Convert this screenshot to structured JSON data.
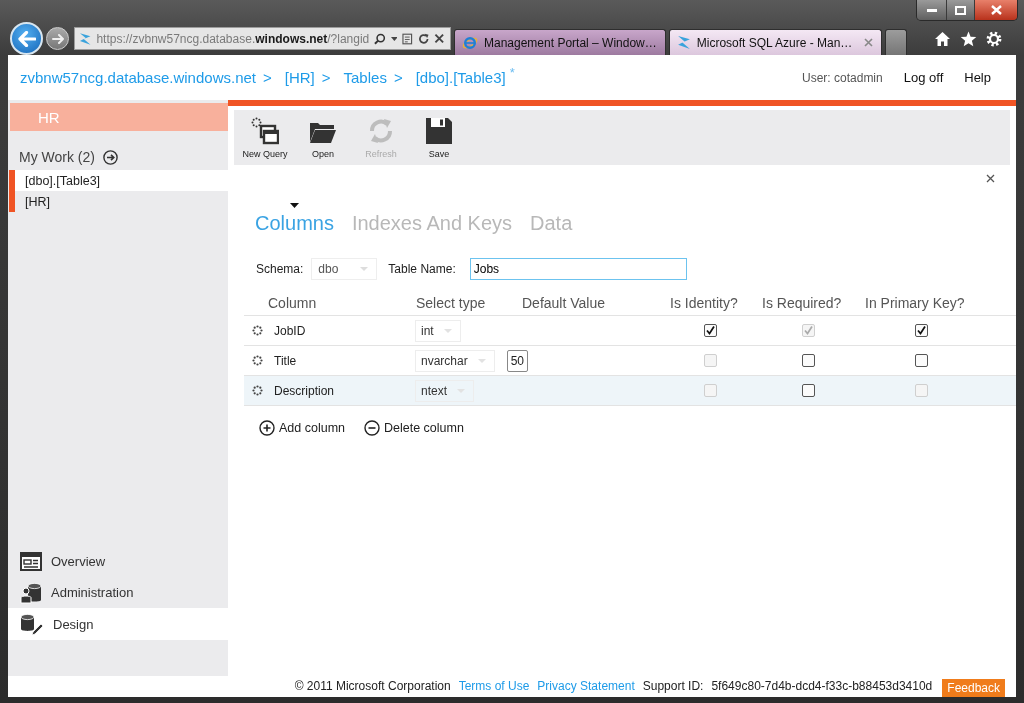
{
  "browser": {
    "address": "https://zvbnw57ncg.database.**windows.net**/?langid",
    "tabs": [
      {
        "title": "Management Portal – Window…",
        "kind": "ie",
        "selected": false
      },
      {
        "title": "Microsoft SQL Azure - Man…",
        "kind": "azure",
        "selected": true
      }
    ]
  },
  "header": {
    "breadcrumb": [
      {
        "label": "zvbnw57ncg.database.windows.net",
        "separator": ">"
      },
      {
        "label": "[HR]",
        "separator": ">"
      },
      {
        "label": "Tables",
        "separator": ">"
      },
      {
        "label": "[dbo].[Table3]"
      }
    ],
    "modified_mark": "*",
    "user": "User: cotadmin",
    "links": [
      "Log off",
      "Help"
    ]
  },
  "sidebar": {
    "title": "HR",
    "my_work": "My Work (2)",
    "items": [
      {
        "label": "[dbo].[Table3]",
        "selected": true
      },
      {
        "label": "[HR]",
        "selected": false
      }
    ],
    "nav": [
      {
        "label": "Overview",
        "kind": "overview",
        "selected": false
      },
      {
        "label": "Administration",
        "kind": "administration",
        "selected": false
      },
      {
        "label": "Design",
        "kind": "design",
        "selected": true
      }
    ]
  },
  "toolbar": {
    "buttons": [
      {
        "label": "New Query",
        "kind": "new-query",
        "disabled": false
      },
      {
        "label": "Open",
        "kind": "open",
        "disabled": false
      },
      {
        "label": "Refresh",
        "kind": "refresh",
        "disabled": true
      },
      {
        "label": "Save",
        "kind": "save",
        "disabled": false
      }
    ]
  },
  "designer": {
    "tabs": [
      {
        "label": "Columns",
        "selected": true
      },
      {
        "label": "Indexes And Keys",
        "selected": false
      },
      {
        "label": "Data",
        "selected": false
      }
    ],
    "schema_label": "Schema:",
    "schema": "dbo",
    "table_name_label": "Table Name:",
    "table_name": "Jobs"
  },
  "table": {
    "columns": [
      "Column",
      "Select type",
      "Default Value",
      "Is Identity?",
      "Is Required?",
      "In Primary Key?"
    ],
    "rows": [
      {
        "name": "JobID",
        "type": "int",
        "highlighted": false,
        "identity": {
          "checked": true,
          "disabled": false
        },
        "required": {
          "checked": true,
          "disabled": true
        },
        "primary_key": {
          "checked": true,
          "disabled": false
        }
      },
      {
        "name": "Title",
        "type": "nvarchar",
        "length": "50",
        "highlighted": false,
        "identity": {
          "checked": false,
          "disabled": true
        },
        "required": {
          "checked": false,
          "disabled": false
        },
        "primary_key": {
          "checked": false,
          "disabled": false
        }
      },
      {
        "name": "Description",
        "type": "ntext",
        "highlighted": true,
        "identity": {
          "checked": false,
          "disabled": true
        },
        "required": {
          "checked": false,
          "disabled": false
        },
        "primary_key": {
          "checked": false,
          "disabled": true
        }
      }
    ]
  },
  "actions": [
    {
      "label": "Add column",
      "kind": "add"
    },
    {
      "label": "Delete column",
      "kind": "delete"
    }
  ],
  "footer": {
    "copyright": "© 2011 Microsoft Corporation",
    "links": [
      "Terms of Use",
      "Privacy Statement"
    ],
    "support_label": "Support ID:",
    "support_id": "5f649c80-7d4b-dcd4-f33c-b88453d3410d",
    "feedback": "Feedback"
  }
}
